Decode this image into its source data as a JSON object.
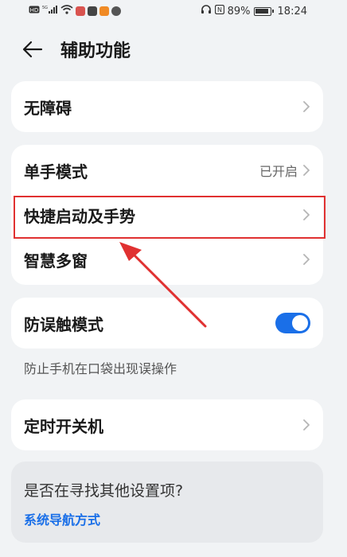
{
  "status_bar": {
    "battery": "89%",
    "time": "18:24",
    "signal_label": "5G"
  },
  "header": {
    "title": "辅助功能"
  },
  "sections": {
    "accessibility": {
      "label": "无障碍"
    },
    "one_hand": {
      "label": "单手模式",
      "value": "已开启"
    },
    "quick_start": {
      "label": "快捷启动及手势"
    },
    "smart_multiwindow": {
      "label": "智慧多窗"
    },
    "mistouch": {
      "label": "防误触模式",
      "enabled": true,
      "helper": "防止手机在口袋出现误操作"
    },
    "timer_power": {
      "label": "定时开关机"
    }
  },
  "search_card": {
    "title": "是否在寻找其他设置项?",
    "link": "系统导航方式"
  },
  "colors": {
    "accent": "#1a6fe8",
    "highlight": "#e03131",
    "background": "#f1f3f5"
  }
}
